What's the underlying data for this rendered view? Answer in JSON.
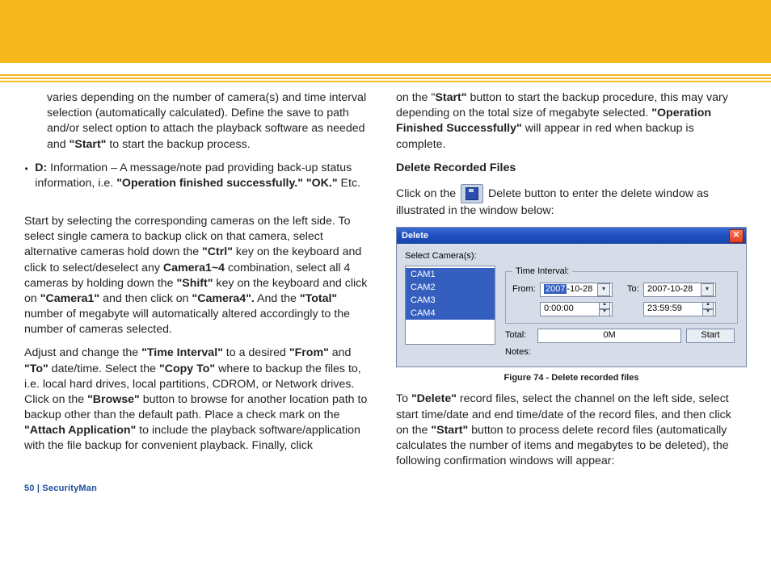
{
  "header": {},
  "left": {
    "p1": "varies depending on the number of camera(s) and time interval selection (automatically calculated).  Define the save to path and/or select option to attach the playback software as needed and ",
    "p1b": "\"Start\"",
    "p1c": " to start the backup process.",
    "bullet_label": "D:",
    "bullet_text_a": " Information – A message/note pad providing back-up status information, i.e. ",
    "bullet_text_b": "\"Operation finished successfully.\" \"OK.\"",
    "bullet_text_c": " Etc.",
    "p2a": "Start by selecting the corresponding cameras on the left side.  To select single camera to backup click on that camera, select alternative cameras hold down the ",
    "p2_ctrl": "\"Ctrl\"",
    "p2b": " key on the keyboard and click to select/deselect any ",
    "p2_cam": "Camera1~4",
    "p2c": " combination, select all 4 cameras by holding down the ",
    "p2_shift": "\"Shift\"",
    "p2d": " key on the keyboard and click on ",
    "p2_c1": "\"Camera1\"",
    "p2e": " and then click on ",
    "p2_c4": "\"Camera4\".",
    "p2f": "  And the ",
    "p2_total": "\"Total\"",
    "p2g": " number of megabyte will automatically altered accordingly to the number of cameras selected.",
    "p3a": "Adjust and change the ",
    "p3_ti": "\"Time Interval\"",
    "p3b": " to a desired ",
    "p3_from": "\"From\"",
    "p3c": " and ",
    "p3_to": "\"To\"",
    "p3d": " date/time.  Select the ",
    "p3_copy": "\"Copy To\"",
    "p3e": " where to backup the files to, i.e. local hard drives, local partitions, CDROM, or Network drives.  Click on the ",
    "p3_browse": "\"Browse\"",
    "p3f": " button to browse for another location path to backup other than the default path. Place a check mark on the ",
    "p3_attach": "\"Attach Application\"",
    "p3g": " to include the playback software/application with the file backup for convenient playback.  Finally, click "
  },
  "right": {
    "p1a": "on the \"",
    "p1_start": "Start\"",
    "p1b": " button to start the backup procedure, this may vary depending on the total size of megabyte selected.  ",
    "p1_ofs": "\"Operation Finished Successfully\"",
    "p1c": " will appear in red when backup is complete.",
    "h_delete": "Delete Recorded Files",
    "p2a": "Click on the ",
    "p2b": " Delete button to enter the delete window as illustrated in the window below:",
    "caption": "Figure 74 - Delete recorded files",
    "p3a": "To ",
    "p3_del": "\"Delete\"",
    "p3b": " record files, select the channel on the left side, select start time/date and end time/date of the record files, and then click on the ",
    "p3_start": "\"Start\"",
    "p3c": " button to process delete record files (automatically calculates the number of items and megabytes to be deleted), the following confirmation windows will appear:"
  },
  "dialog": {
    "title": "Delete",
    "select_label": "Select Camera(s):",
    "cams": [
      "CAM1",
      "CAM2",
      "CAM3",
      "CAM4"
    ],
    "ti_legend": "Time Interval:",
    "from_label": "From:",
    "to_label": "To:",
    "from_date_year": "2007",
    "from_date_rest": "-10-28",
    "to_date": "2007-10-28",
    "from_time": "0:00:00",
    "to_time": "23:59:59",
    "total_label": "Total:",
    "total_value": "0M",
    "start_label": "Start",
    "notes_label": "Notes:"
  },
  "footer": {
    "text": "50  |  SecurityMan"
  }
}
